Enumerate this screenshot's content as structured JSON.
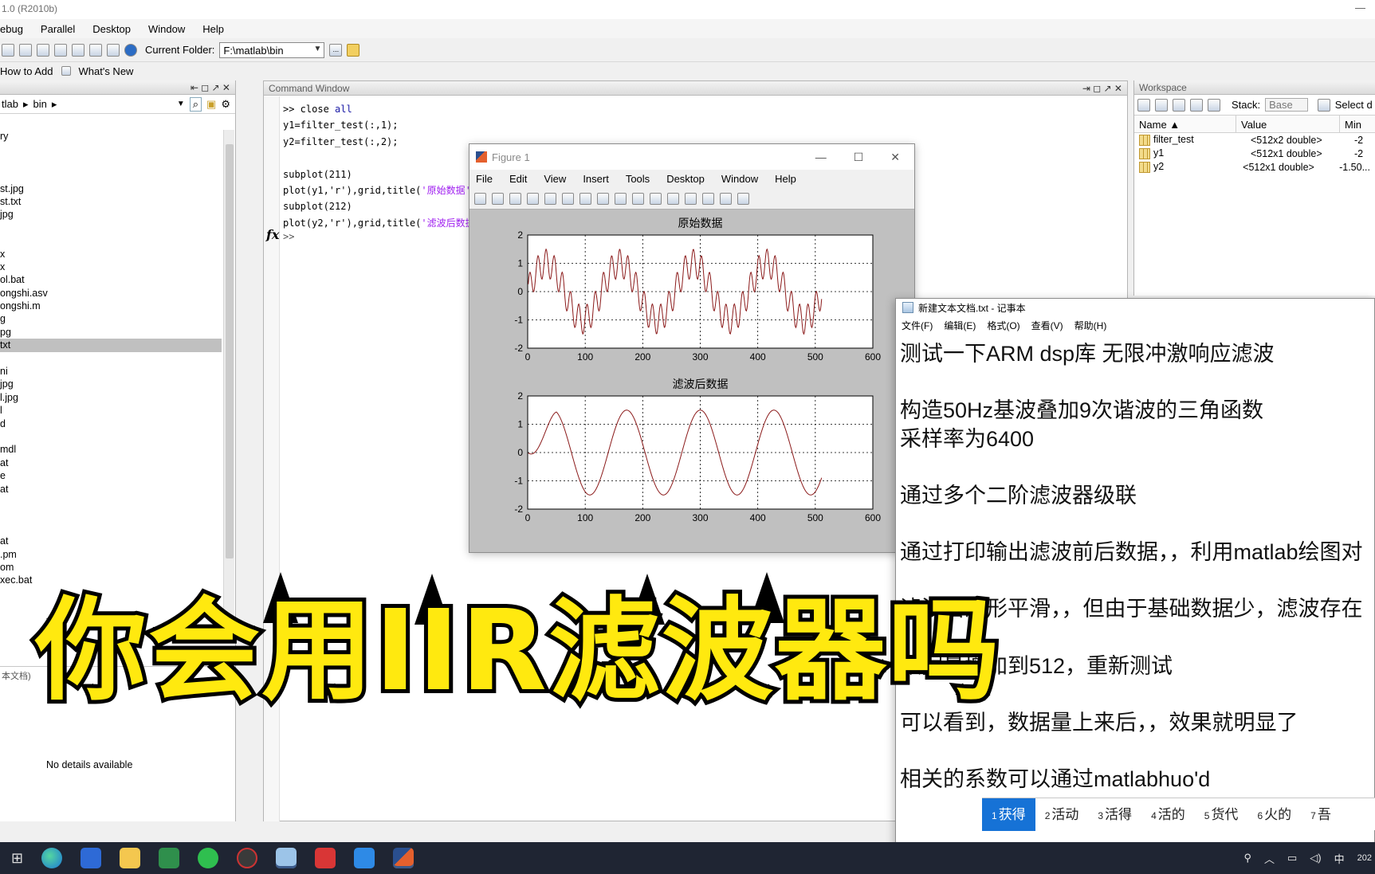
{
  "window_title": "1.0 (R2010b)",
  "menu": [
    "ebug",
    "Parallel",
    "Desktop",
    "Window",
    "Help"
  ],
  "toolbar": {
    "current_folder_label": "Current Folder:",
    "current_folder": "F:\\matlab\\bin",
    "browse": "..."
  },
  "shortcuts": {
    "how_to_add": "How to Add",
    "whats_new": "What's New"
  },
  "current_folder_panel": {
    "path": [
      "tlab",
      "bin"
    ],
    "files": [
      "ry",
      "",
      "",
      "",
      "st.jpg",
      "st.txt",
      "jpg",
      "",
      "",
      "x",
      "x",
      "ol.bat",
      "ongshi.asv",
      "ongshi.m",
      "g",
      "pg",
      "txt",
      "",
      "ni",
      "jpg",
      "l.jpg",
      "l",
      "d",
      "",
      "mdl",
      "at",
      "e",
      "at",
      "",
      "",
      "",
      "at",
      ".pm",
      "om",
      "xec.bat"
    ],
    "selected_index": 16,
    "details_text": "No details available",
    "footer_fragment": "本文档)"
  },
  "command_window": {
    "title": "Command Window",
    "prompt": ">>",
    "fx": "fx",
    "lines": [
      [
        {
          "t": ">> close "
        },
        {
          "t": "all",
          "c": "blue"
        }
      ],
      [
        {
          "t": "y1=filter_test(:,1);"
        }
      ],
      [
        {
          "t": "y2=filter_test(:,2);"
        }
      ],
      [
        {
          "t": ""
        }
      ],
      [
        {
          "t": "subplot(211)"
        }
      ],
      [
        {
          "t": "plot(y1,'r'),grid,title("
        },
        {
          "t": "'原始数据'",
          "c": "str"
        }
      ],
      [
        {
          "t": "subplot(212)"
        }
      ],
      [
        {
          "t": "plot(y2,'r'),grid,title("
        },
        {
          "t": "'滤波后数据",
          "c": "str"
        }
      ]
    ]
  },
  "workspace": {
    "title": "Workspace",
    "stack_label": "Stack:",
    "stack_value": "Base",
    "select_label": "Select d",
    "columns": [
      "Name ▲",
      "Value",
      "Min"
    ],
    "rows": [
      {
        "name": "filter_test",
        "value": "<512x2 double>",
        "min": "-2"
      },
      {
        "name": "y1",
        "value": "<512x1 double>",
        "min": "-2"
      },
      {
        "name": "y2",
        "value": "<512x1 double>",
        "min": "-1.50..."
      }
    ]
  },
  "figure": {
    "title": "Figure 1",
    "menu": [
      "File",
      "Edit",
      "View",
      "Insert",
      "Tools",
      "Desktop",
      "Window",
      "Help"
    ]
  },
  "chart_data": [
    {
      "type": "line",
      "title": "原始数据",
      "xlabel": "",
      "ylabel": "",
      "xlim": [
        0,
        600
      ],
      "ylim": [
        -2,
        2
      ],
      "xticks": [
        0,
        100,
        200,
        300,
        400,
        500,
        600
      ],
      "yticks": [
        2,
        1,
        0,
        -1,
        -2
      ],
      "grid": true,
      "series": [
        {
          "color": "#8b1a1a",
          "n": 512,
          "x_end": 511,
          "period": 128,
          "components": [
            {
              "harmonic": 1,
              "amp": 1.0
            },
            {
              "harmonic": 9,
              "amp": 0.5
            }
          ]
        }
      ]
    },
    {
      "type": "line",
      "title": "滤波后数据",
      "xlabel": "",
      "ylabel": "",
      "xlim": [
        0,
        600
      ],
      "ylim": [
        -2,
        2
      ],
      "xticks": [
        0,
        100,
        200,
        300,
        400,
        500,
        600
      ],
      "yticks": [
        2,
        1,
        0,
        -1,
        -2
      ],
      "grid": true,
      "series": [
        {
          "color": "#8b1a1a",
          "n": 512,
          "x_end": 511,
          "period": 128,
          "amp": 1.5,
          "phase_lag": 12
        }
      ]
    }
  ],
  "notepad": {
    "title": "新建文本文档.txt - 记事本",
    "menu": [
      "文件(F)",
      "编辑(E)",
      "格式(O)",
      "查看(V)",
      "帮助(H)"
    ],
    "lines": [
      "测试一下ARM dsp库 无限冲激响应滤波",
      "",
      "构造50Hz基波叠加9次谐波的三角函数",
      "采样率为6400",
      "",
      "通过多个二阶滤波器级联",
      "",
      "通过打印输出滤波前后数据，，利用matlab绘图对",
      "",
      "滤波后波形平滑，，但由于基础数据少，滤波存在",
      "",
      "数据量增加到512，重新测试",
      "",
      "可以看到，数据量上来后，，效果就明显了",
      "",
      "相关的系数可以通过matlabhuo'd"
    ]
  },
  "ime": {
    "candidates": [
      {
        "n": "1",
        "w": "获得"
      },
      {
        "n": "2",
        "w": "活动"
      },
      {
        "n": "3",
        "w": "活得"
      },
      {
        "n": "4",
        "w": "活的"
      },
      {
        "n": "5",
        "w": "货代"
      },
      {
        "n": "6",
        "w": "火的"
      },
      {
        "n": "7",
        "w": "吾"
      }
    ]
  },
  "overlay_caption": "你会用IIR滤波器吗",
  "taskbar": {
    "tray_lang": "中",
    "clock_fragment": "202"
  }
}
